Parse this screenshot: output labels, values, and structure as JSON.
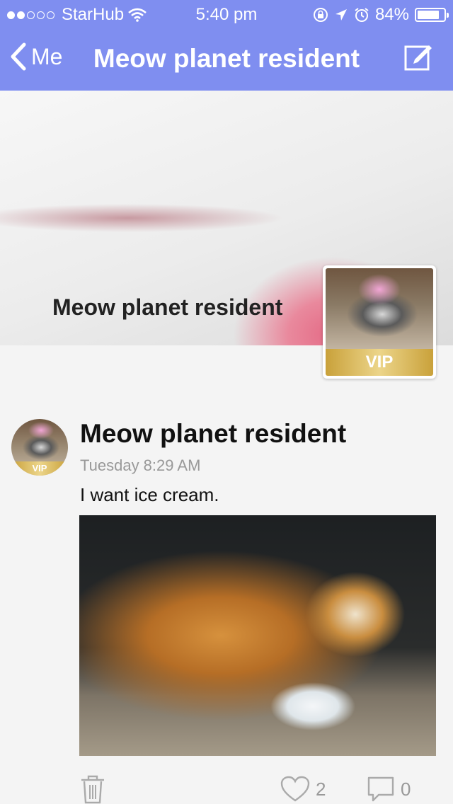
{
  "status_bar": {
    "carrier": "StarHub",
    "time": "5:40 pm",
    "battery": "84%",
    "battery_level": 0.84,
    "signal_bars_filled": 2,
    "signal_bars_total": 5,
    "icons": [
      "wifi-icon",
      "rotation-lock-icon",
      "location-icon",
      "alarm-icon",
      "battery-icon"
    ]
  },
  "nav": {
    "back_label": "Me",
    "title": "Meow planet resident",
    "edit_icon": "compose-icon"
  },
  "profile": {
    "name": "Meow planet resident",
    "badge": "VIP"
  },
  "post": {
    "author": "Meow planet resident",
    "badge": "VIP",
    "time": "Tuesday 8:29 AM",
    "text": "I want ice cream.",
    "likes": "2",
    "comments": "0"
  },
  "colors": {
    "header": "#7f8ef0",
    "vip_gold": "#d4b04c",
    "muted_text": "#999999"
  }
}
